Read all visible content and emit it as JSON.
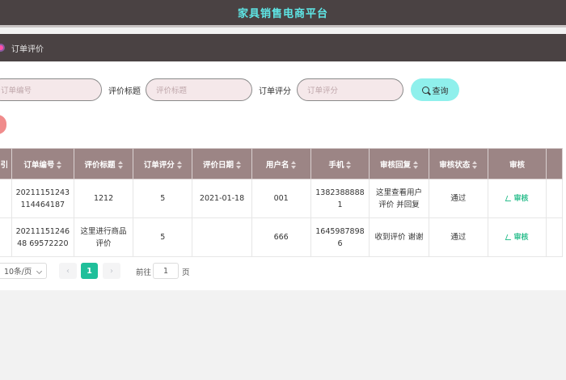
{
  "header": {
    "title": "家具销售电商平台"
  },
  "breadcrumb": {
    "label": "订单评价"
  },
  "search": {
    "order_no_placeholder": "订单编号",
    "title_label": "评价标题",
    "title_placeholder": "评价标题",
    "score_label": "订单评分",
    "score_placeholder": "订单评分",
    "search_button": "查询"
  },
  "table": {
    "columns": [
      "引",
      "订单编号",
      "评价标题",
      "订单评分",
      "评价日期",
      "用户名",
      "手机",
      "审核回复",
      "审核状态",
      "审核"
    ],
    "rows": [
      {
        "order_no": "20211151243114464187",
        "title": "1212",
        "score": "5",
        "date": "2021-01-18",
        "username": "001",
        "phone": "13823888881",
        "reply": "这里查看用户评价 并回复",
        "status": "通过",
        "action": "审核"
      },
      {
        "order_no": "2021115124648 69572220",
        "title": "这里进行商品评价",
        "score": "5",
        "date": "",
        "username": "666",
        "phone": "16459878986",
        "reply": "收到评价 谢谢",
        "status": "通过",
        "action": "审核"
      }
    ]
  },
  "pager": {
    "page_size": "10条/页",
    "prev": "‹",
    "current": "1",
    "next": "›",
    "goto_label": "前往",
    "goto_value": "1",
    "page_unit": "页"
  }
}
